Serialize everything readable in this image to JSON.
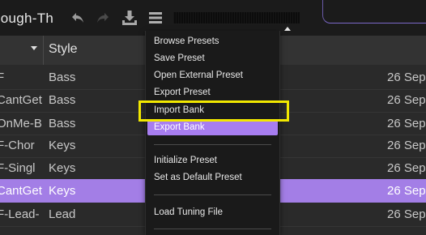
{
  "toolbar": {
    "preset_name": "nough-Th",
    "icons": {
      "undo": "undo-arrow-icon",
      "redo": "redo-arrow-icon",
      "install": "install-tray-icon",
      "menu": "menu-stack-icon"
    }
  },
  "table": {
    "style_header": "Style",
    "rows": [
      {
        "name": "F",
        "style": "Bass",
        "date": "26 Sep",
        "selected": false
      },
      {
        "name": "CantGet",
        "style": "Bass",
        "date": "26 Sep",
        "selected": false
      },
      {
        "name": "OnMe-B",
        "style": "Bass",
        "date": "26 Sep",
        "selected": false
      },
      {
        "name": "F-Chor",
        "style": "Keys",
        "date": "26 Sep",
        "selected": false
      },
      {
        "name": "F-Singl",
        "style": "Keys",
        "date": "26 Sep",
        "selected": false
      },
      {
        "name": "CantGet",
        "style": "Keys",
        "date": "26 Sep",
        "selected": true
      },
      {
        "name": "F-Lead-",
        "style": "Lead",
        "date": "26 Sep",
        "selected": false
      }
    ]
  },
  "dropdown": {
    "items": [
      "Browse Presets",
      "Save Preset",
      "Open External Preset",
      "Export Preset",
      "Import Bank",
      "Export Bank",
      "Initialize Preset",
      "Set as Default Preset",
      "Load Tuning File"
    ],
    "hovered": "Export Bank",
    "highlighted": "Import Bank"
  },
  "colors": {
    "accent": "#a37ee6",
    "highlight_box": "#f2e800",
    "background": "#2a2a2a",
    "menu_bg": "#1a1a1a"
  }
}
